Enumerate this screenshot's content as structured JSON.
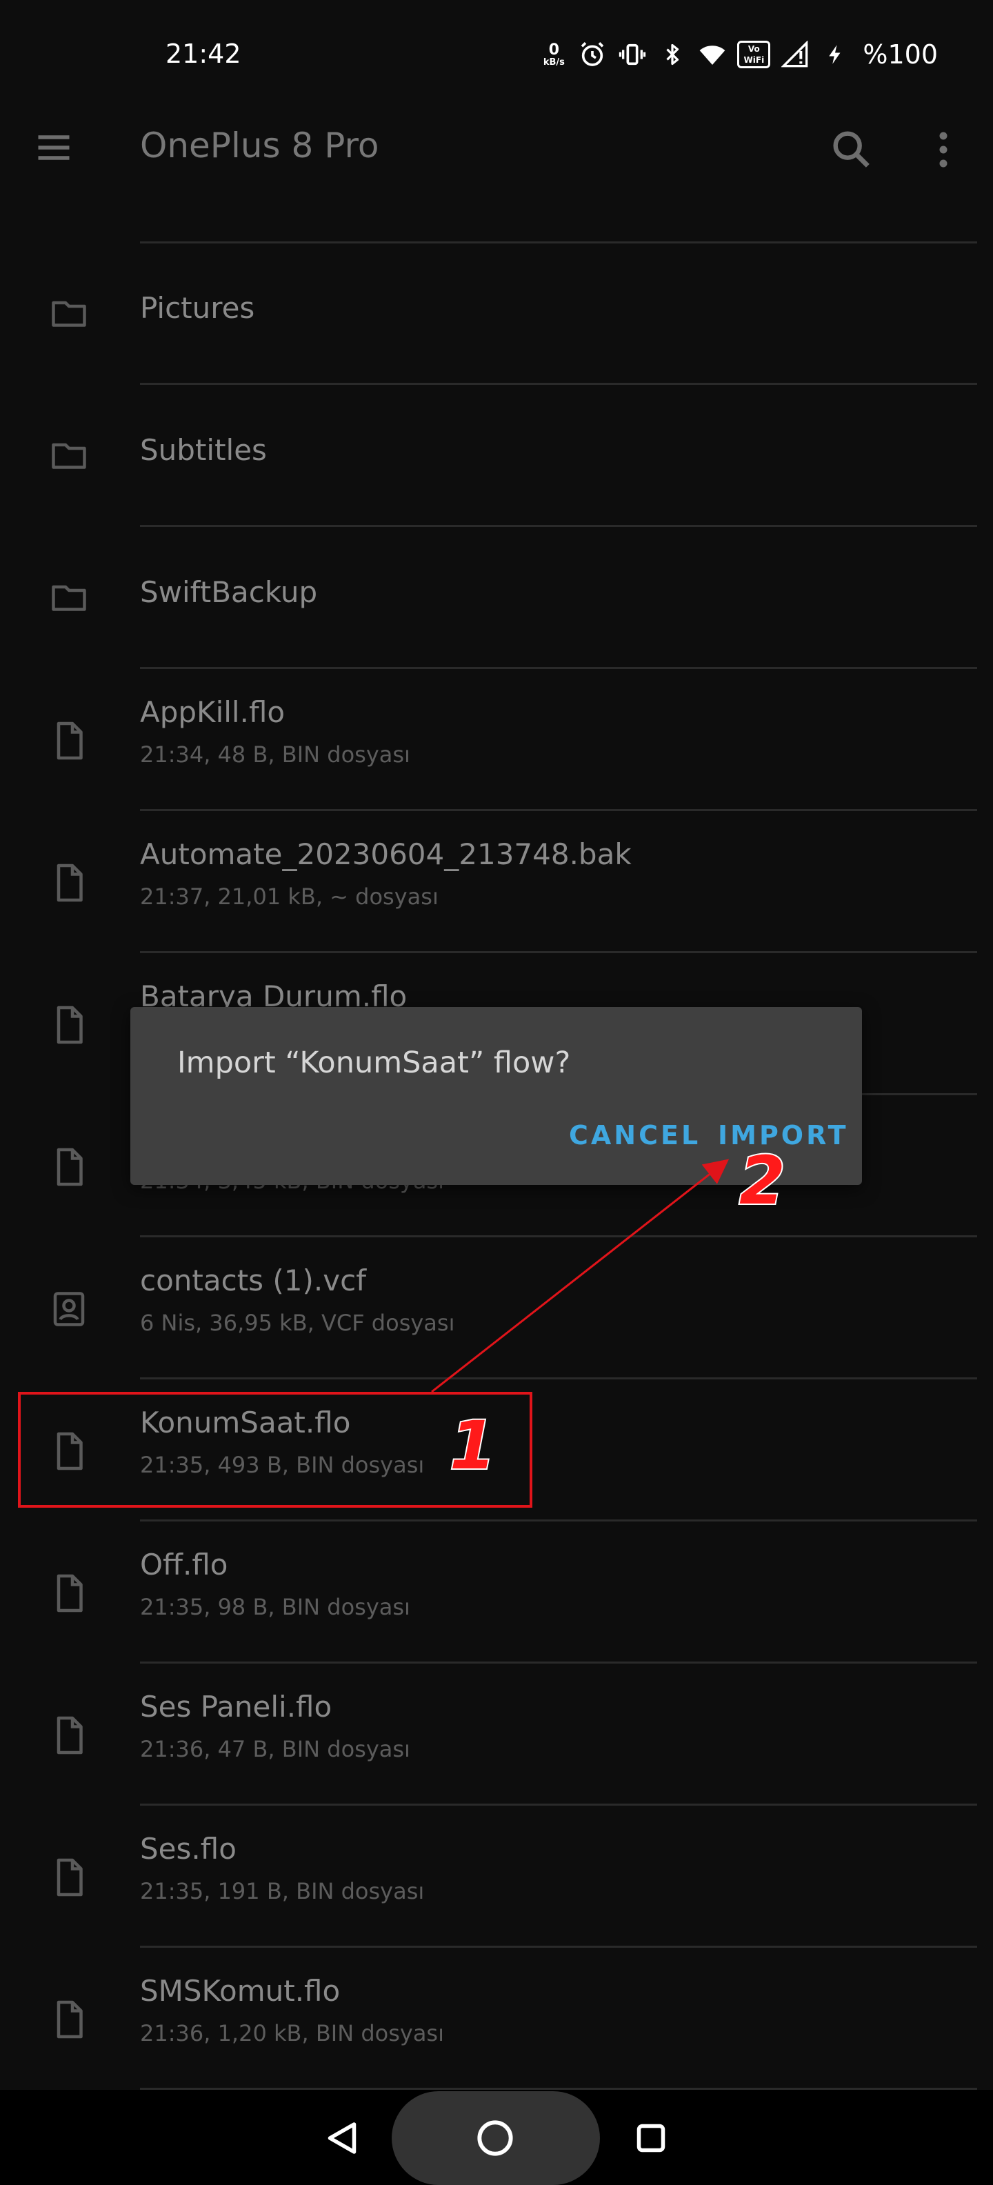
{
  "status_bar": {
    "time": "21:42",
    "net_speed_value": "0",
    "net_speed_unit": "kB/s",
    "vowifi_line1": "Vo",
    "vowifi_line2": "WiFi",
    "battery": "%100",
    "icons": [
      "alarm-icon",
      "vibrate-icon",
      "bluetooth-icon",
      "wifi-icon",
      "vowifi-icon",
      "signal-icon",
      "charging-icon"
    ]
  },
  "app_bar": {
    "title": "OnePlus 8 Pro",
    "menu_icon": "hamburger-menu-icon",
    "search_icon": "search-icon",
    "more_icon": "more-vert-icon"
  },
  "files": [
    {
      "type": "folder",
      "name": "Pictures"
    },
    {
      "type": "folder",
      "name": "Subtitles"
    },
    {
      "type": "folder",
      "name": "SwiftBackup"
    },
    {
      "type": "file",
      "name": "AppKill.flo",
      "meta": "21:34, 48 B, BIN dosyası"
    },
    {
      "type": "file",
      "name": "Automate_20230604_213748.bak",
      "meta": "21:37, 21,01 kB, ~ dosyası"
    },
    {
      "type": "file",
      "name": "Batarya Durum.flo",
      "meta": ""
    },
    {
      "type": "file",
      "name": "",
      "meta": "21:34, 3,45 kB, BIN dosyası"
    },
    {
      "type": "contact",
      "name": "contacts (1).vcf",
      "meta": "6 Nis, 36,95 kB, VCF dosyası"
    },
    {
      "type": "file",
      "name": "KonumSaat.flo",
      "meta": "21:35, 493 B, BIN dosyası"
    },
    {
      "type": "file",
      "name": "Off.flo",
      "meta": "21:35, 98 B, BIN dosyası"
    },
    {
      "type": "file",
      "name": "Ses Paneli.flo",
      "meta": "21:36, 47 B, BIN dosyası"
    },
    {
      "type": "file",
      "name": "Ses.flo",
      "meta": "21:35, 191 B, BIN dosyası"
    },
    {
      "type": "file",
      "name": "SMSKomut.flo",
      "meta": "21:36, 1,20 kB, BIN dosyası"
    }
  ],
  "dialog": {
    "message": "Import “KonumSaat” flow?",
    "cancel_label": "CANCEL",
    "import_label": "IMPORT"
  },
  "annotations": {
    "step1": "1",
    "step2": "2",
    "color": "#e0141a"
  },
  "colors": {
    "background": "#0d0d0d",
    "dialog_bg": "#404040",
    "accent": "#3fa7e0"
  }
}
